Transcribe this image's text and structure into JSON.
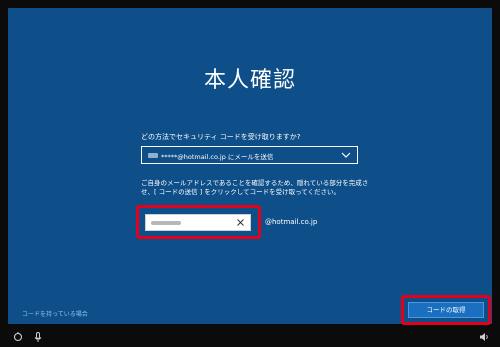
{
  "page": {
    "title": "本人確認",
    "question": "どの方法でセキュリティ コードを受け取りますか?",
    "method_select": {
      "value": "*****@hotmail.co.jp にメールを送信"
    },
    "instructions": "ご自身のメールアドレスであることを確認するため、隠れている部分を完成させ、[ コードの送信 ] をクリックしてコードを受け取ってください。",
    "email_input": {
      "value": "",
      "placeholder": ""
    },
    "email_domain": "@hotmail.co.jp",
    "have_code_link": "コードを持っている場合",
    "get_code_button": "コードの取得"
  },
  "taskbar": {
    "icons": [
      "accessibility-icon",
      "microphone-icon",
      "volume-icon"
    ]
  },
  "colors": {
    "panel": "#0e4f8a",
    "highlight": "#e3001b",
    "button": "#1a6fc0",
    "link": "#8fc3ee"
  }
}
